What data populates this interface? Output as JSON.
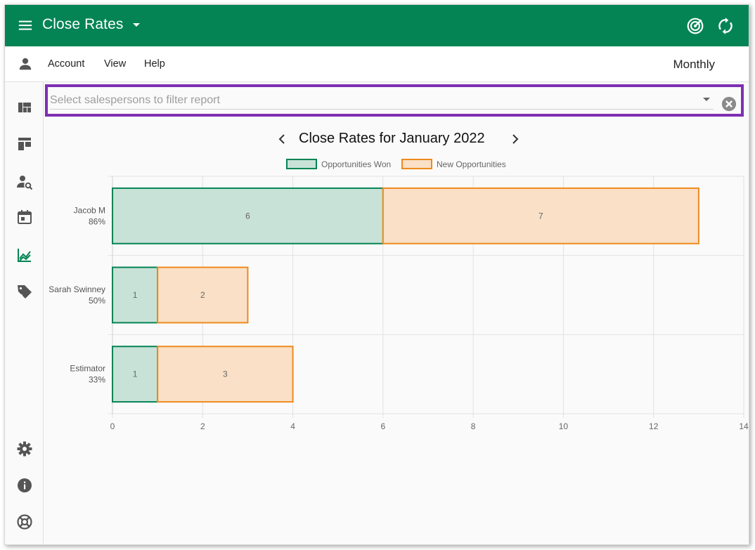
{
  "app": {
    "title": "Close Rates",
    "accent_color": "#048454"
  },
  "menubar": {
    "items": [
      "Account",
      "View",
      "Help"
    ],
    "period": "Monthly"
  },
  "rail": {
    "icons": [
      "dashboard-icon",
      "board-icon",
      "person-search-icon",
      "calendar-icon",
      "chart-icon",
      "tag-icon",
      "settings-icon",
      "info-icon",
      "support-icon"
    ],
    "active": "chart-icon"
  },
  "filter": {
    "placeholder": "Select salespersons to filter report",
    "value": ""
  },
  "chart_header": {
    "title": "Close Rates for January 2022"
  },
  "chart_data": {
    "type": "bar",
    "orientation": "horizontal",
    "stacked": true,
    "categories": [
      "Jacob M",
      "Sarah Swinney",
      "Estimator"
    ],
    "category_sublabels": [
      "86%",
      "50%",
      "33%"
    ],
    "series": [
      {
        "name": "Opportunities Won",
        "values": [
          6,
          1,
          1
        ],
        "color": "#048454",
        "fill": "#c8e2d8"
      },
      {
        "name": "New Opportunities",
        "values": [
          7,
          2,
          3
        ],
        "color": "#ef8a1e",
        "fill": "#f9e0c6"
      }
    ],
    "xlim": [
      0,
      14
    ],
    "xticks": [
      0,
      2,
      4,
      6,
      8,
      10,
      12,
      14
    ],
    "grid": true,
    "legend_position": "top"
  }
}
